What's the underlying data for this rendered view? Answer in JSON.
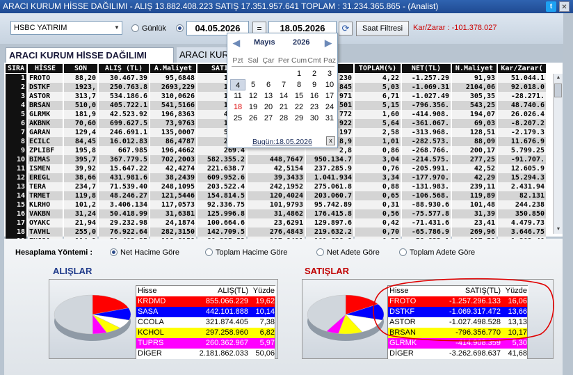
{
  "title": "ARACI KURUM HİSSE DAĞILIMI - ALIŞ 13.882.408.223  SATIŞ 17.351.957.641  TOPLAM : 31.234.365.865 - (Analist)",
  "toolbar": {
    "broker": "HSBC YATIRIM",
    "gunluk_label": "Günlük",
    "date_from": "04.05.2026",
    "eq": "=",
    "date_to": "18.05.2026",
    "refresh_button": "Saat Filtresi",
    "kar_zarar": "Kar/Zarar : -101.378.027"
  },
  "tabs": [
    {
      "label": "ARACI KURUM HİSSE DAĞILIMI"
    },
    {
      "label": "ARACI KUR"
    }
  ],
  "grid": {
    "headers": [
      "SIRA",
      "HİSSE",
      "SON",
      "ALIŞ (TL)",
      "A.Maliyet",
      "SATIŞ",
      "",
      "TL)",
      "TOPLAM(%)",
      "NET(TL)",
      "N.Maliyet",
      "Kar/Zarar("
    ],
    "rows": [
      [
        "1",
        "FROTO",
        "88,20",
        "30.467.39",
        "95,6848",
        "1.287",
        "",
        "230",
        "4,22",
        "-1.257.29",
        "91,93",
        "51.044.1"
      ],
      [
        "2",
        "DSTKF",
        "1923,",
        "250.763.8",
        "2693,229",
        "1.320",
        "",
        "845",
        "5,03",
        "-1.069.31",
        "2104,06",
        "92.018.0"
      ],
      [
        "3",
        "ASTOR",
        "313,7",
        "534.186.6",
        "310,0626",
        "1.561",
        "",
        "971",
        "6,71",
        "-1.027.49",
        "305,35",
        "-28.271."
      ],
      [
        "4",
        "BRSAN",
        "510,0",
        "405.722.1",
        "541,5166",
        "1.202",
        "",
        "501",
        "5,15",
        "-796.356.",
        "543,25",
        "48.740.6"
      ],
      [
        "5",
        "GLRMK",
        "181,9",
        "42.523.92",
        "196,8363",
        "457.4",
        "",
        "772",
        "1,60",
        "-414.908.",
        "194,07",
        "26.026.4"
      ],
      [
        "6",
        "AKBNK",
        "70,60",
        "699.627.5",
        "73,9763",
        "1.060",
        "",
        "922",
        "5,64",
        "-361.067.",
        "69,03",
        "-8.207.2"
      ],
      [
        "7",
        "GARAN",
        "129,4",
        "246.691.1",
        "135,0007",
        "560.6",
        "",
        "197",
        "2,58",
        "-313.968.",
        "128,51",
        "-2.179.3"
      ],
      [
        "8",
        "ECILC",
        "84,45",
        "16.012.83",
        "86,4787",
        "298.5",
        "",
        "8,9",
        "1,01",
        "-282.573.",
        "88,09",
        "11.676.9"
      ],
      [
        "9",
        "ZPLIBF",
        "195,8",
        "667.985",
        "196,4662",
        "269.4",
        "",
        "2,8",
        "0,86",
        "-268.766.",
        "200,17",
        "5.799.25"
      ],
      [
        "10",
        "BIMAS",
        "395,7",
        "367.779.5",
        "702,2003",
        "582.355.2",
        "448,7647",
        "950.134.7",
        "3,04",
        "-214.575.",
        "277,25",
        "-91.707."
      ],
      [
        "11",
        "ISMEN",
        "39,92",
        "15.647.22",
        "42,4274",
        "221.638.7",
        "42,5154",
        "237.285.9",
        "0,76",
        "-205.991.",
        "42,52",
        "12.605.9"
      ],
      [
        "12",
        "EREGL",
        "38,66",
        "431.981.6",
        "38,2439",
        "609.952.6",
        "39,3433",
        "1.041.934",
        "3,34",
        "-177.970.",
        "42,29",
        "15.294.3"
      ],
      [
        "13",
        "TERA",
        "234,7",
        "71.539.40",
        "248,1095",
        "203.522.4",
        "242,1952",
        "275.061.8",
        "0,88",
        "-131.983.",
        "239,11",
        "2.431.94"
      ],
      [
        "14",
        "TRMET",
        "119,8",
        "48.246.27",
        "121,5446",
        "154.814.5",
        "120,4024",
        "203.060.7",
        "0,65",
        "-106.568.",
        "119,89",
        "82.131"
      ],
      [
        "15",
        "KLRHO",
        "101,2",
        "3.406.134",
        "117,0573",
        "92.336.75",
        "101,9793",
        "95.742.89",
        "0,31",
        "-88.930.6",
        "101,48",
        "244.238"
      ],
      [
        "16",
        "VAKBN",
        "31,24",
        "50.418.99",
        "31,6381",
        "125.996.8",
        "31,4862",
        "176.415.8",
        "0,56",
        "-75.577.8",
        "31,39",
        "350.850"
      ],
      [
        "17",
        "OYAKC",
        "21,94",
        "29.232.98",
        "24,1874",
        "100.664.6",
        "23,6291",
        "129.897.6",
        "0,42",
        "-71.431.6",
        "23,41",
        "4.479.73"
      ],
      [
        "18",
        "TAVHL",
        "255,0",
        "76.922.64",
        "282,3150",
        "142.709.5",
        "276,4843",
        "219.632.2",
        "0,70",
        "-65.786.9",
        "269,96",
        "3.646.75"
      ],
      [
        "19",
        "ENJSA",
        "114,9",
        "21.403.35",
        "118,8158",
        "80.235.52",
        "117,8491",
        "101.638.8",
        "0,33",
        "-58.832.1",
        "117,50",
        "1.302.40"
      ],
      [
        "20",
        "TRGYO",
        "99,00",
        "8.993.073",
        "99,4157",
        "66.474.19",
        "97,7769",
        "75.363.26",
        "0,24",
        "-57.578.1",
        "97,52",
        "-281.459"
      ]
    ]
  },
  "bottom": {
    "method_label": "Hesaplama Yöntemi :",
    "options": [
      "Net Hacime Göre",
      "Toplam Hacime Göre",
      "Net Adete Göre",
      "Toplam Adete Göre"
    ],
    "alislar": {
      "title": "ALIŞLAR",
      "headers": [
        "Hisse",
        "ALIŞ(TL)",
        "Yüzde"
      ],
      "rows": [
        {
          "name": "KRDMD",
          "value": "855.066.229",
          "pct": "19,62",
          "bg": "#ff0000",
          "fg": "#ffffff"
        },
        {
          "name": "SASA",
          "value": "442.101.888",
          "pct": "10,14",
          "bg": "#0000ff",
          "fg": "#ffffff"
        },
        {
          "name": "CCOLA",
          "value": "321.874.405",
          "pct": "7,38",
          "bg": "#ffffff",
          "fg": "#000000"
        },
        {
          "name": "KCHOL",
          "value": "297.258.960",
          "pct": "6,82",
          "bg": "#ffff00",
          "fg": "#000000"
        },
        {
          "name": "TUPRS",
          "value": "260.362.967",
          "pct": "5,97",
          "bg": "#ff00ff",
          "fg": "#ffffff"
        },
        {
          "name": "DİGER",
          "value": "2.181.862.033",
          "pct": "50,06",
          "bg": "#ffffff",
          "fg": "#000000"
        }
      ]
    },
    "satislar": {
      "title": "SATIŞLAR",
      "headers": [
        "Hisse",
        "SATIŞ(TL)",
        "Yüzde"
      ],
      "rows": [
        {
          "name": "FROTO",
          "value": "-1.257.296.133",
          "pct": "16,06",
          "bg": "#ff0000",
          "fg": "#ffffff"
        },
        {
          "name": "DSTKF",
          "value": "-1.069.317.472",
          "pct": "13,66",
          "bg": "#0000ff",
          "fg": "#ffffff"
        },
        {
          "name": "ASTOR",
          "value": "-1.027.498.528",
          "pct": "13,13",
          "bg": "#ffffff",
          "fg": "#000000"
        },
        {
          "name": "BRSAN",
          "value": "-796.356.770",
          "pct": "10,17",
          "bg": "#ffff00",
          "fg": "#000000"
        },
        {
          "name": "GLRMK",
          "value": "-414.908.359",
          "pct": "5,30",
          "bg": "#ff00ff",
          "fg": "#ffffff"
        },
        {
          "name": "DİGER",
          "value": "-3.262.698.637",
          "pct": "41,68",
          "bg": "#ffffff",
          "fg": "#000000"
        }
      ]
    }
  },
  "calendar": {
    "month": "Mayıs",
    "year": "2026",
    "dows": [
      "Pzt",
      "Sal",
      "Çar",
      "Per",
      "Cum",
      "Cmt",
      "Paz"
    ],
    "weeks": [
      [
        "",
        "",
        "",
        "",
        "1",
        "2",
        "3"
      ],
      [
        "4",
        "5",
        "6",
        "7",
        "8",
        "9",
        "10"
      ],
      [
        "11",
        "12",
        "13",
        "14",
        "15",
        "16",
        "17"
      ],
      [
        "18",
        "19",
        "20",
        "21",
        "22",
        "23",
        "24"
      ],
      [
        "25",
        "26",
        "27",
        "28",
        "29",
        "30",
        "31"
      ]
    ],
    "selected": "4",
    "red_day": "18",
    "today": "Bugün:18.05.2026"
  },
  "colors": {
    "title_bg": "#1f4a92",
    "red": "#cc0000",
    "header_bg": "#111111"
  }
}
